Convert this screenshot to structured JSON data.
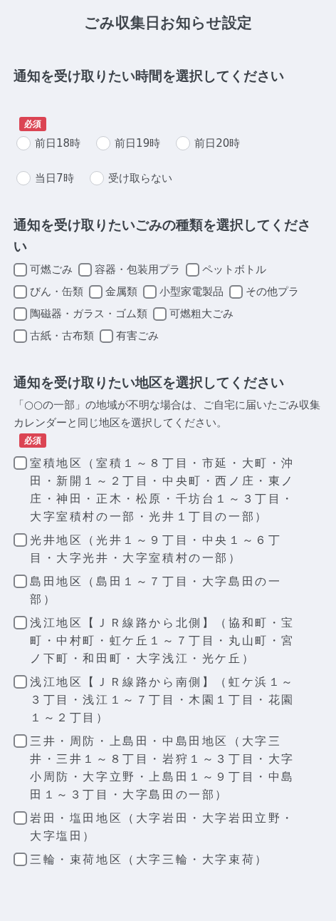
{
  "title": "ごみ収集日お知らせ設定",
  "sections": [
    {
      "heading": "通知を受け取りたい時間を選択してください",
      "badge": "必須",
      "options": [
        {
          "kind": "radio",
          "label": "前日18時",
          "selected": false
        },
        {
          "kind": "radio",
          "label": "前日19時",
          "selected": false
        },
        {
          "kind": "radio",
          "label": "前日20時",
          "selected": false
        },
        {
          "kind": "radio",
          "label": "当日7時",
          "selected": false
        },
        {
          "kind": "radio",
          "label": "受け取らない",
          "selected": false
        }
      ]
    },
    {
      "heading": "通知を受け取りたいごみの種類を選択してください",
      "options": [
        {
          "kind": "checkbox",
          "label": "可燃ごみ",
          "checked": false
        },
        {
          "kind": "checkbox",
          "label": "容器・包装用プラ",
          "checked": false
        },
        {
          "kind": "checkbox",
          "label": "ペットボトル",
          "checked": false
        },
        {
          "kind": "checkbox",
          "label": "びん・缶類",
          "checked": false
        },
        {
          "kind": "checkbox",
          "label": "金属類",
          "checked": false
        },
        {
          "kind": "checkbox",
          "label": "小型家電製品",
          "checked": false
        },
        {
          "kind": "checkbox",
          "label": "その他プラ",
          "checked": false
        },
        {
          "kind": "checkbox",
          "label": "陶磁器・ガラス・ゴム類",
          "checked": false
        },
        {
          "kind": "checkbox",
          "label": "可燃粗大ごみ",
          "checked": false
        },
        {
          "kind": "checkbox",
          "label": "古紙・古布類",
          "checked": false
        },
        {
          "kind": "checkbox",
          "label": "有害ごみ",
          "checked": false
        }
      ]
    },
    {
      "heading": "通知を受け取りたい地区を選択してください",
      "note": "「○○の一部」の地域が不明な場合は、ご自宅に届いたごみ収集カレンダーと同じ地区を選択してください。",
      "badge": "必須",
      "options": [
        {
          "kind": "district",
          "label": "室積地区（室積１～８丁目・市延・大町・沖田・新開１～２丁目・中央町・西ノ庄・東ノ庄・神田・正木・松原・千坊台１～３丁目・大字室積村の一部・光井１丁目の一部）",
          "checked": false
        },
        {
          "kind": "district",
          "label": "光井地区（光井１～９丁目・中央１～６丁目・大字光井・大字室積村の一部）",
          "checked": false
        },
        {
          "kind": "district",
          "label": "島田地区（島田１～７丁目・大字島田の一部）",
          "checked": false
        },
        {
          "kind": "district",
          "label": "浅江地区【ＪＲ線路から北側】（協和町・宝町・中村町・虹ケ丘１～７丁目・丸山町・宮ノ下町・和田町・大字浅江・光ケ丘）",
          "checked": false
        },
        {
          "kind": "district",
          "label": "浅江地区【ＪＲ線路から南側】（虹ケ浜１～３丁目・浅江１～７丁目・木園１丁目・花園１～２丁目）",
          "checked": false
        },
        {
          "kind": "district",
          "label": "三井・周防・上島田・中島田地区（大字三井・三井１～８丁目・岩狩１～３丁目・大字小周防・大字立野・上島田１～９丁目・中島田１～３丁目・大字島田の一部）",
          "checked": false
        },
        {
          "kind": "district",
          "label": "岩田・塩田地区（大字岩田・大字岩田立野・大字塩田）",
          "checked": false
        },
        {
          "kind": "district",
          "label": "三輪・束荷地区（大字三輪・大字束荷）",
          "checked": false
        }
      ]
    }
  ]
}
